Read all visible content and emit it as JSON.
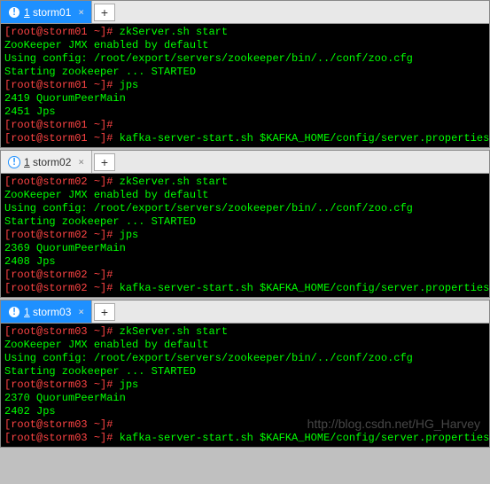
{
  "windows": [
    {
      "tab_num": "1",
      "tab_title": "storm01",
      "active": true,
      "lines": [
        {
          "prompt": "[root@storm01 ~]# ",
          "cmd": "zkServer.sh start"
        },
        {
          "text": "ZooKeeper JMX enabled by default"
        },
        {
          "text": "Using config: /root/export/servers/zookeeper/bin/../conf/zoo.cfg"
        },
        {
          "text": "Starting zookeeper ... STARTED"
        },
        {
          "prompt": "[root@storm01 ~]# ",
          "cmd": "jps"
        },
        {
          "text": "2419 QuorumPeerMain"
        },
        {
          "text": "2451 Jps"
        },
        {
          "prompt": "[root@storm01 ~]#",
          "cmd": ""
        },
        {
          "prompt": "[root@storm01 ~]# ",
          "cmd": "kafka-server-start.sh $KAFKA_HOME/config/server.properties",
          "cursor": true
        }
      ]
    },
    {
      "tab_num": "1",
      "tab_title": "storm02",
      "active": false,
      "lines": [
        {
          "prompt": "[root@storm02 ~]# ",
          "cmd": "zkServer.sh start"
        },
        {
          "text": "ZooKeeper JMX enabled by default"
        },
        {
          "text": "Using config: /root/export/servers/zookeeper/bin/../conf/zoo.cfg"
        },
        {
          "text": "Starting zookeeper ... STARTED"
        },
        {
          "prompt": "[root@storm02 ~]# ",
          "cmd": "jps"
        },
        {
          "text": "2369 QuorumPeerMain"
        },
        {
          "text": "2408 Jps"
        },
        {
          "prompt": "[root@storm02 ~]#",
          "cmd": ""
        },
        {
          "prompt": "[root@storm02 ~]# ",
          "cmd": "kafka-server-start.sh $KAFKA_HOME/config/server.properties",
          "cursor": true
        }
      ]
    },
    {
      "tab_num": "1",
      "tab_title": "storm03",
      "active": true,
      "lines": [
        {
          "prompt": "[root@storm03 ~]# ",
          "cmd": "zkServer.sh start"
        },
        {
          "text": "ZooKeeper JMX enabled by default"
        },
        {
          "text": "Using config: /root/export/servers/zookeeper/bin/../conf/zoo.cfg"
        },
        {
          "text": "Starting zookeeper ... STARTED"
        },
        {
          "prompt": "[root@storm03 ~]# ",
          "cmd": "jps"
        },
        {
          "text": "2370 QuorumPeerMain"
        },
        {
          "text": "2402 Jps"
        },
        {
          "prompt": "[root@storm03 ~]#",
          "cmd": ""
        },
        {
          "prompt": "[root@storm03 ~]# ",
          "cmd": "kafka-server-start.sh $KAFKA_HOME/config/server.properties",
          "cursor": true
        }
      ]
    }
  ],
  "newtab_label": "+",
  "watermark": "http://blog.csdn.net/HG_Harvey"
}
